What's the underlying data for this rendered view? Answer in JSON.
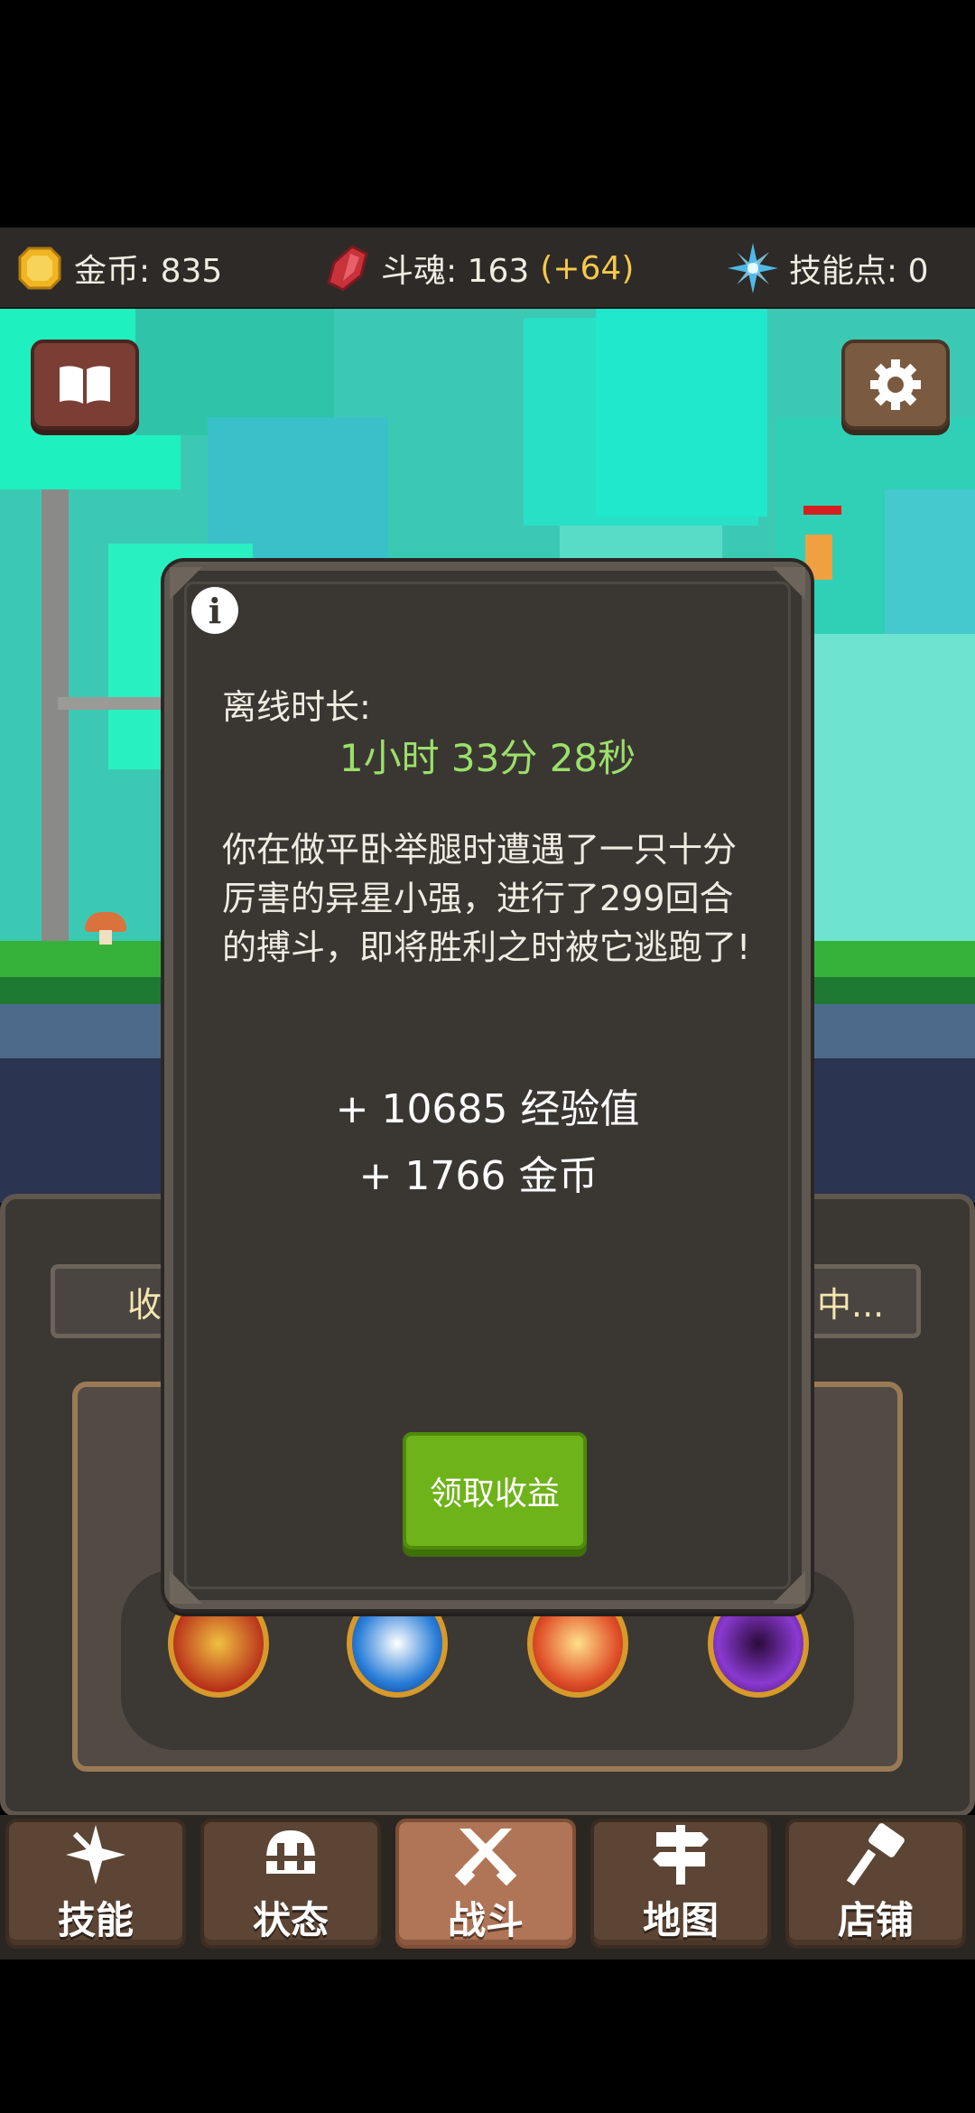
{
  "resources": {
    "gold_label": "金币: 835",
    "soul_label": "斗魂: 163",
    "soul_bonus": "(+64)",
    "skill_points_label": "技能点: 0"
  },
  "background_tabs": {
    "left_partial": "收",
    "right_partial": "中..."
  },
  "dialog": {
    "offline_label": "离线时长:",
    "offline_time": "1小时 33分 28秒",
    "story": "你在做平卧举腿时遭遇了一只十分厉害的异星小强，进行了299回合的搏斗，即将胜利之时被它逃跑了!",
    "exp_reward": "+ 10685 经验值",
    "gold_reward": "+ 1766 金币",
    "claim_button": "领取收益"
  },
  "nav": [
    {
      "label": "技能",
      "icon": "sparkle-icon"
    },
    {
      "label": "状态",
      "icon": "helmet-icon"
    },
    {
      "label": "战斗",
      "icon": "crossed-swords-icon",
      "active": true
    },
    {
      "label": "地图",
      "icon": "signpost-icon"
    },
    {
      "label": "店铺",
      "icon": "hammer-icon"
    }
  ],
  "colors": {
    "accent_green": "#9be06a",
    "bonus_yellow": "#f5c84a",
    "claim_green": "#6fb31a"
  }
}
